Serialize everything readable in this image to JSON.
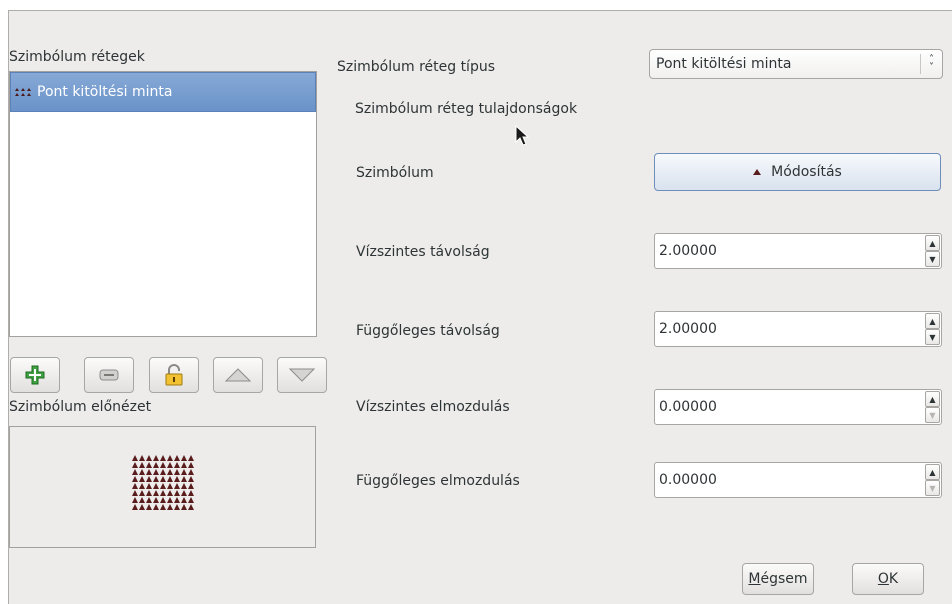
{
  "layers": {
    "heading": "Szimbólum rétegek",
    "items": [
      {
        "label": "Pont kitöltési minta",
        "selected": true
      }
    ]
  },
  "toolbar": {
    "add_icon": "plus-icon",
    "remove_icon": "minus-icon",
    "lock_icon": "lock-icon",
    "up_icon": "arrow-up-icon",
    "down_icon": "arrow-down-icon"
  },
  "preview": {
    "heading": "Szimbólum előnézet"
  },
  "layer_type": {
    "label": "Szimbólum réteg típus",
    "value": "Pont kitöltési minta"
  },
  "properties": {
    "heading": "Szimbólum réteg tulajdonságok",
    "symbol_label": "Szimbólum",
    "modify_button": "Módosítás",
    "horizontal_distance": {
      "label": "Vízszintes távolság",
      "value": "2.00000"
    },
    "vertical_distance": {
      "label": "Függőleges távolság",
      "value": "2.00000"
    },
    "horizontal_offset": {
      "label": "Vízszintes elmozdulás",
      "value": "0.00000"
    },
    "vertical_offset": {
      "label": "Függőleges elmozdulás",
      "value": "0.00000"
    }
  },
  "dialog_buttons": {
    "cancel_mnemonic": "M",
    "cancel_rest": "égsem",
    "ok_mnemonic": "O",
    "ok_rest": "K"
  },
  "colors": {
    "selection": "#6b93c9",
    "marker": "#5a1d1d"
  }
}
